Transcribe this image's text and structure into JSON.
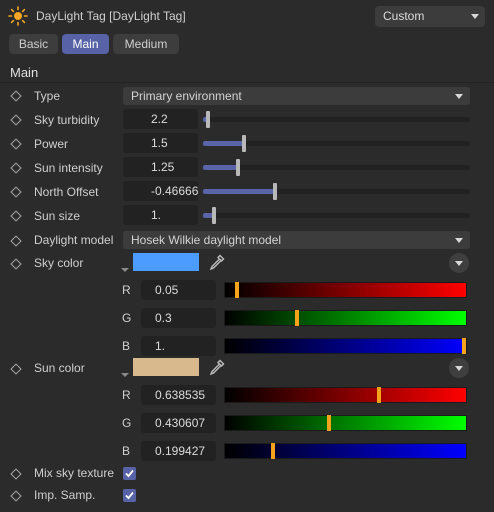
{
  "header": {
    "title": "DayLight Tag [DayLight Tag]",
    "preset": "Custom",
    "icon": "sun-icon"
  },
  "tabs": [
    {
      "label": "Basic",
      "active": false
    },
    {
      "label": "Main",
      "active": true
    },
    {
      "label": "Medium",
      "active": false
    }
  ],
  "section": {
    "title": "Main"
  },
  "params": {
    "type": {
      "label": "Type",
      "value": "Primary environment"
    },
    "sky_turbidity": {
      "label": "Sky turbidity",
      "value": "2.2",
      "level": 0.02
    },
    "power": {
      "label": "Power",
      "value": "1.5",
      "level": 0.155
    },
    "sun_intensity": {
      "label": "Sun intensity",
      "value": "1.25",
      "level": 0.13
    },
    "north_offset": {
      "label": "North Offset",
      "value": "-0.466667",
      "level": 0.27
    },
    "sun_size": {
      "label": "Sun size",
      "value": "1.",
      "level": 0.04
    },
    "daylight_model": {
      "label": "Daylight model",
      "value": "Hosek Wilkie daylight model"
    },
    "sky_color": {
      "label": "Sky color",
      "swatch": "#4c9cff",
      "r": {
        "label": "R",
        "value": "0.05",
        "level": 0.05
      },
      "g": {
        "label": "G",
        "value": "0.3",
        "level": 0.3
      },
      "b": {
        "label": "B",
        "value": "1.",
        "level": 1.0
      }
    },
    "sun_color": {
      "label": "Sun color",
      "swatch": "#d8b98e",
      "r": {
        "label": "R",
        "value": "0.638535",
        "level": 0.638535
      },
      "g": {
        "label": "G",
        "value": "0.430607",
        "level": 0.430607
      },
      "b": {
        "label": "B",
        "value": "0.199427",
        "level": 0.199427
      }
    },
    "mix_sky_texture": {
      "label": "Mix sky texture",
      "checked": true
    },
    "imp_samp": {
      "label": "Imp. Samp.",
      "checked": true
    }
  },
  "colors": {
    "accent": "#5763a6",
    "slider_fill": "#5a65a8",
    "channel_thumb": "#f5a31a"
  }
}
